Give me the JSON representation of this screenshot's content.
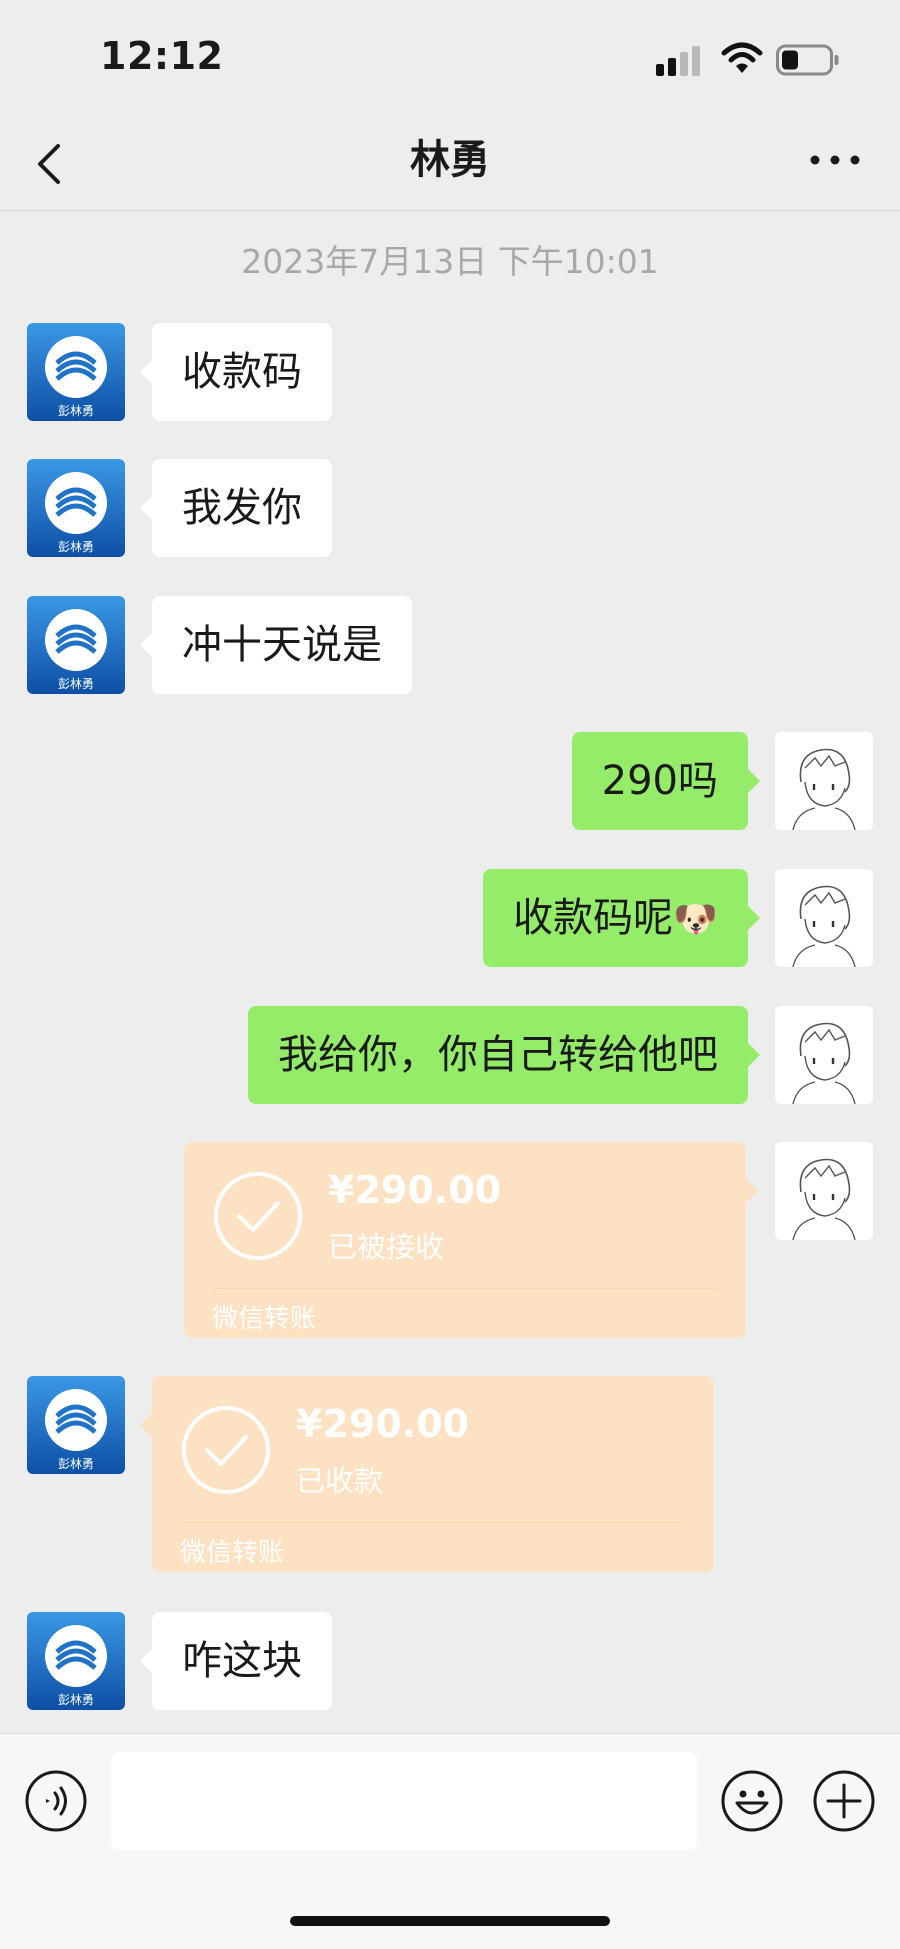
{
  "status_bar": {
    "time": "12:12"
  },
  "nav": {
    "title": "林勇"
  },
  "chat": {
    "timestamp": "2023年7月13日 下午10:01",
    "contact_avatar_caption": "彭林勇",
    "messages": [
      {
        "side": "in",
        "type": "text",
        "text": "收款码"
      },
      {
        "side": "in",
        "type": "text",
        "text": "我发你"
      },
      {
        "side": "in",
        "type": "text",
        "text": "冲十天说是"
      },
      {
        "side": "out",
        "type": "text",
        "text": "290吗"
      },
      {
        "side": "out",
        "type": "text",
        "text": "收款码呢",
        "emoji": "🐶"
      },
      {
        "side": "out",
        "type": "text",
        "text": "我给你，你自己转给他吧"
      },
      {
        "side": "out",
        "type": "transfer",
        "amount": "¥290.00",
        "status": "已被接收",
        "footer": "微信转账"
      },
      {
        "side": "in",
        "type": "transfer",
        "amount": "¥290.00",
        "status": "已收款",
        "footer": "微信转账"
      },
      {
        "side": "in",
        "type": "text",
        "text": "咋这块"
      }
    ]
  },
  "input": {
    "value": "",
    "placeholder": ""
  },
  "colors": {
    "background": "#ededed",
    "outgoing_bubble": "#95ec69",
    "incoming_bubble": "#ffffff",
    "transfer_card": "#fde1c3"
  }
}
